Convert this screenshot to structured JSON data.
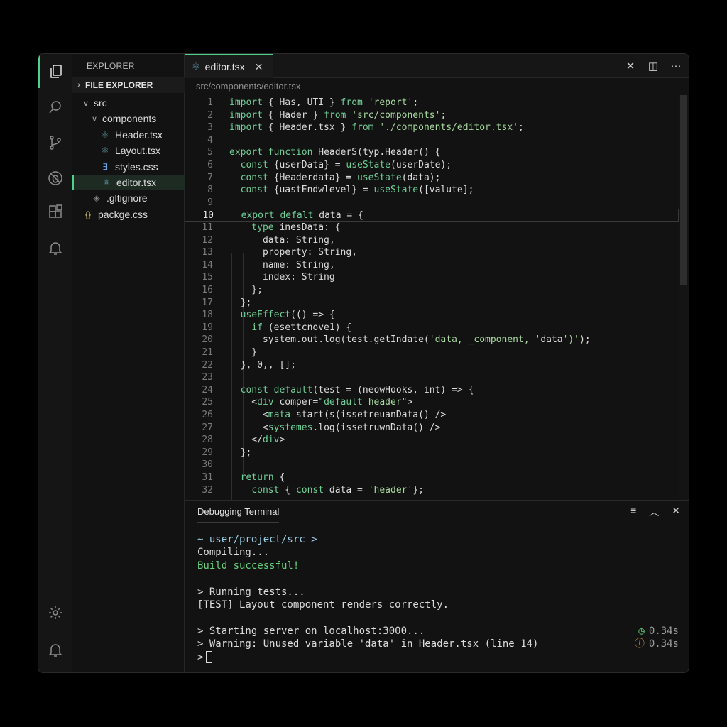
{
  "activity_bar": {
    "items": [
      {
        "name": "files",
        "icon": "files-icon"
      },
      {
        "name": "search",
        "icon": "search-icon"
      },
      {
        "name": "source-control",
        "icon": "git-branch-icon"
      },
      {
        "name": "debug",
        "icon": "no-bug-icon"
      },
      {
        "name": "extensions",
        "icon": "extensions-icon"
      },
      {
        "name": "notifications",
        "icon": "bell-icon"
      }
    ],
    "bottom": [
      {
        "name": "settings",
        "icon": "gear-icon"
      },
      {
        "name": "account",
        "icon": "bell-icon"
      }
    ]
  },
  "sidebar": {
    "title": "EXPLORER",
    "section": "FILE EXPLORER",
    "tree": [
      {
        "label": "src",
        "indent": 1,
        "twist": "∨",
        "icon": ""
      },
      {
        "label": "components",
        "indent": 2,
        "twist": "∨",
        "icon": ""
      },
      {
        "label": "Header.tsx",
        "indent": 3,
        "icon": "react-icon"
      },
      {
        "label": "Layout.tsx",
        "indent": 3,
        "icon": "react-icon"
      },
      {
        "label": "styles.css",
        "indent": 3,
        "icon": "css-icon"
      },
      {
        "label": "editor.tsx",
        "indent": 3,
        "icon": "react-icon",
        "selected": true
      },
      {
        "label": ".gltignore",
        "indent": 2,
        "icon": "diamond-icon"
      },
      {
        "label": "packge.css",
        "indent": 1,
        "icon": "braces-icon"
      }
    ]
  },
  "editor": {
    "tab": {
      "label": "editor.tsx",
      "close": "✕"
    },
    "breadcrumb": "src/components/editor.tsx",
    "current_line": 10,
    "lines": [
      "import { Has, UTI } from 'report';",
      "import { Hader } from 'src/components';",
      "import { Header.tsx } from './components/editor.tsx';",
      "",
      "export function HeaderS(typ.Header() {",
      "  const {userData} = useState(userDate);",
      "  const {Headerdata} = useState(data);",
      "  const {uastEndwlevel} = useState([valute];",
      "",
      "  export defalt data = {",
      "    type inesData: {",
      "      data: String,",
      "      property: String,",
      "      name: String,",
      "      index: String",
      "    };",
      "  };",
      "  useEffect(() => {",
      "    if (esettcnove1) {",
      "      system.out.log(test.getIndate('data, _component, 'data')');",
      "    }",
      "  }, 0,, [];",
      "",
      "  const default(test = (neowHooks, int) => {",
      "    <div comper=\"default header\">",
      "      <mata start(s(issetreuanData() />",
      "      <systemes.log(issetruwnData() />",
      "    </div>",
      "  };",
      "",
      "  return {",
      "    const { const data = 'header'};"
    ]
  },
  "terminal": {
    "title": "Debugging Terminal",
    "lines": [
      {
        "text": "~ user/project/src >_",
        "kind": "path"
      },
      {
        "text": "Compiling...",
        "kind": "plain"
      },
      {
        "text": "Build successful!",
        "kind": "ok"
      },
      {
        "text": "",
        "kind": "plain"
      },
      {
        "text": "> Running tests...",
        "kind": "plain"
      },
      {
        "text": "[TEST] Layout component renders correctly.",
        "kind": "plain"
      },
      {
        "text": "",
        "kind": "plain"
      },
      {
        "text": "> Starting server on localhost:3000...",
        "kind": "plain",
        "time": "0.34s",
        "time_icon": "clock-icon"
      },
      {
        "text": "> Warning: Unused variable 'data' in Header.tsx (line 14)",
        "kind": "plain",
        "time": "0.34s",
        "time_icon": "warning-icon"
      },
      {
        "text": ">",
        "kind": "prompt"
      }
    ]
  },
  "colors": {
    "accent": "#4fd18b",
    "keyword": "#6fcf97",
    "string": "#a8d8a0",
    "success": "#62d27e",
    "warning": "#e0a050"
  }
}
